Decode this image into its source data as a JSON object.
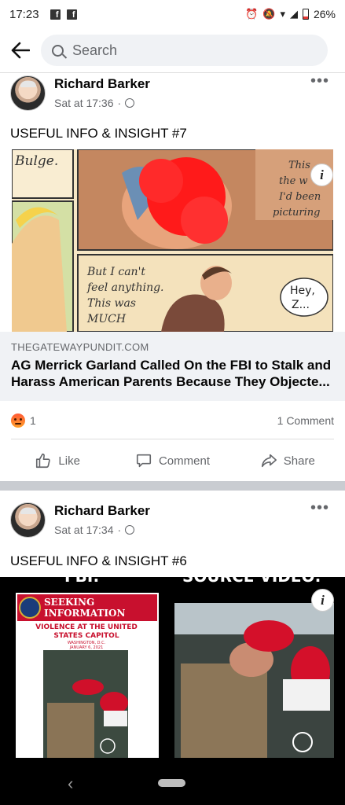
{
  "status_bar": {
    "time": "17:23",
    "battery": "26%"
  },
  "search": {
    "placeholder": "Search"
  },
  "posts": [
    {
      "author": "Richard Barker",
      "time": "Sat at 17:36",
      "separator": "·",
      "text": "USEFUL INFO & INSIGHT #7",
      "image_text": {
        "top_left": "Bulge.",
        "top_right_1": "This",
        "top_right_2": "the w",
        "top_right_3": "I'd been",
        "top_right_4": "picturing",
        "bottom_1": "But I can't",
        "bottom_2": "feel anything.",
        "bottom_3": "This was",
        "bottom_4": "MUCH",
        "bubble_1": "Hey,",
        "bubble_2": "Z..."
      },
      "info_icon": "i",
      "link": {
        "domain": "THEGATEWAYPUNDIT.COM",
        "title_line1": "AG Merrick Garland Called On the FBI to Stalk and",
        "title_line2": "Harass American Parents Because They Objecte..."
      },
      "reaction_count": "1",
      "comment_count": "1 Comment",
      "actions": {
        "like": "Like",
        "comment": "Comment",
        "share": "Share"
      }
    },
    {
      "author": "Richard Barker",
      "time": "Sat at 17:34",
      "separator": "·",
      "text": "USEFUL INFO & INSIGHT #6",
      "image_text": {
        "header_left": "FBI:",
        "header_right": "SOURCE VIDEO:",
        "poster_title1": "SEEKING",
        "poster_title2": "INFORMATION",
        "poster_sub1": "VIOLENCE AT THE UNITED",
        "poster_sub2": "STATES CAPITOL",
        "poster_place": "WASHINGTON, D.C.",
        "poster_date": "JANUARY 6, 2021"
      },
      "info_icon": "i"
    }
  ],
  "colors": {
    "accent": "#1877f2",
    "meta": "#65676b",
    "link_bg": "#f0f2f5"
  }
}
